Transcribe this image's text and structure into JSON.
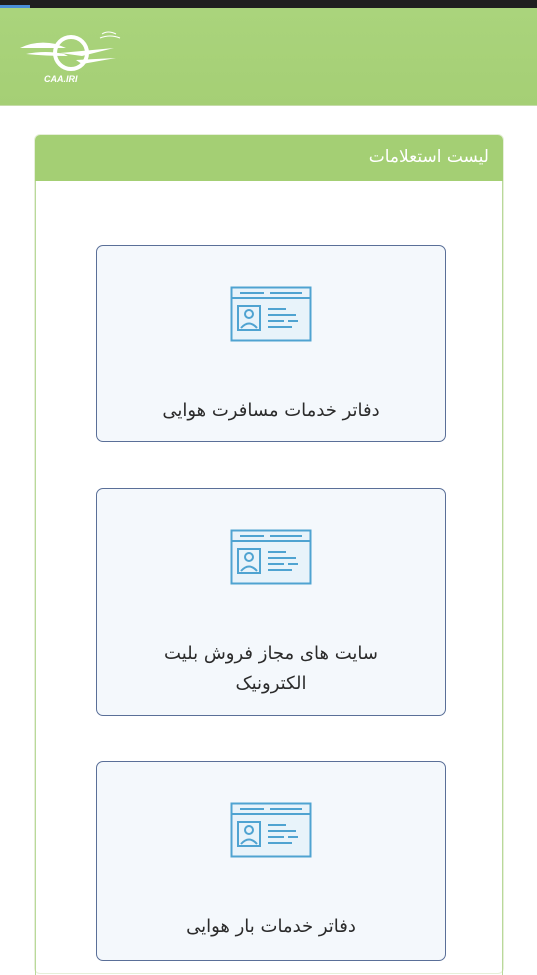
{
  "header": {
    "logo_text": "CAA.IRI",
    "logo_icon": "caa-wing-logo-icon"
  },
  "panel": {
    "title": "لیست استعلامات"
  },
  "cards": [
    {
      "label": "دفاتر خدمات مسافرت هوایی",
      "icon": "id-card-icon"
    },
    {
      "label": "سایت های مجاز فروش بلیت الکترونیک",
      "icon": "id-card-icon"
    },
    {
      "label": "دفاتر خدمات بار هوایی",
      "icon": "id-card-icon"
    }
  ],
  "colors": {
    "header_green": "#a5cf75",
    "panel_header_green": "#a4cf74",
    "card_background": "#f4f8fc",
    "card_border": "#5a6f98",
    "icon_blue": "#4fa3d1"
  }
}
